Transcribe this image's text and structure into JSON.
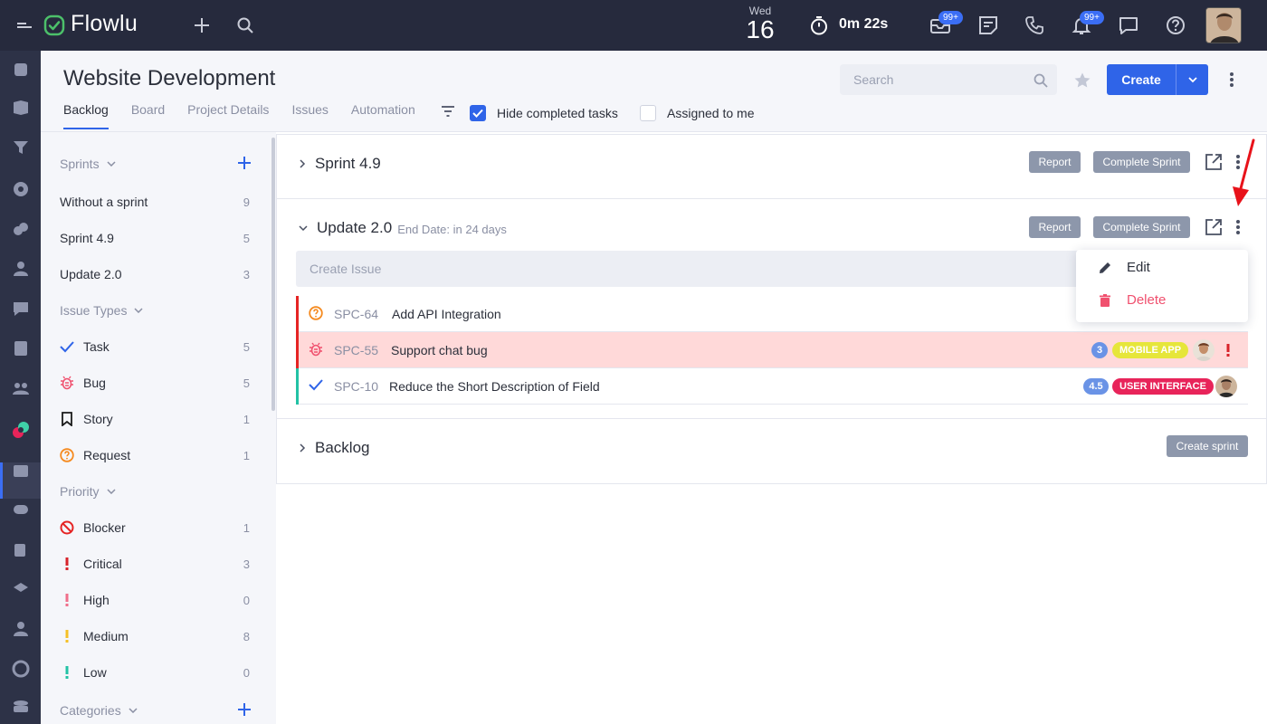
{
  "topbar": {
    "logo": "Flowlu",
    "day_name": "Wed",
    "day_number": "16",
    "timer": "0m 22s",
    "mail_badge": "99+",
    "notifications_badge": "99+"
  },
  "header": {
    "title": "Website Development",
    "tabs": [
      "Backlog",
      "Board",
      "Project Details",
      "Issues",
      "Automation"
    ],
    "hide_completed_label": "Hide completed tasks",
    "assigned_to_me_label": "Assigned to me",
    "search_placeholder": "Search",
    "create_label": "Create"
  },
  "sidebar": {
    "sprints_label": "Sprints",
    "sprints": [
      {
        "label": "Without a sprint",
        "count": "9"
      },
      {
        "label": "Sprint 4.9",
        "count": "5"
      },
      {
        "label": "Update 2.0",
        "count": "3"
      }
    ],
    "issue_types_label": "Issue Types",
    "issue_types": [
      {
        "label": "Task",
        "count": "5"
      },
      {
        "label": "Bug",
        "count": "5"
      },
      {
        "label": "Story",
        "count": "1"
      },
      {
        "label": "Request",
        "count": "1"
      }
    ],
    "priority_label": "Priority",
    "priorities": [
      {
        "label": "Blocker",
        "count": "1"
      },
      {
        "label": "Critical",
        "count": "3"
      },
      {
        "label": "High",
        "count": "0"
      },
      {
        "label": "Medium",
        "count": "8"
      },
      {
        "label": "Low",
        "count": "0"
      }
    ],
    "categories_label": "Categories"
  },
  "main": {
    "sprint1": {
      "title": "Sprint 4.9",
      "report": "Report",
      "complete": "Complete Sprint"
    },
    "sprint2": {
      "title": "Update 2.0",
      "end_date": "End Date: in 24 days",
      "report": "Report",
      "complete": "Complete Sprint",
      "create_issue": "Create Issue"
    },
    "issues": [
      {
        "key": "SPC-64",
        "title": "Add API Integration"
      },
      {
        "key": "SPC-55",
        "title": "Support chat bug",
        "points": "3",
        "tag": "MOBILE APP"
      },
      {
        "key": "SPC-10",
        "title": "Reduce the Short Description of Field",
        "points": "4.5",
        "tag": "USER INTERFACE"
      }
    ],
    "backlog": {
      "title": "Backlog",
      "create_sprint": "Create sprint"
    }
  },
  "dropdown": {
    "edit": "Edit",
    "delete": "Delete"
  },
  "colors": {
    "accent": "#2f64e8",
    "topbar": "#262a3d",
    "bug_row": "#ffd9d9",
    "delete": "#f0506e",
    "tag_mobile": "#e6e63a",
    "tag_ui": "#e8245a"
  }
}
